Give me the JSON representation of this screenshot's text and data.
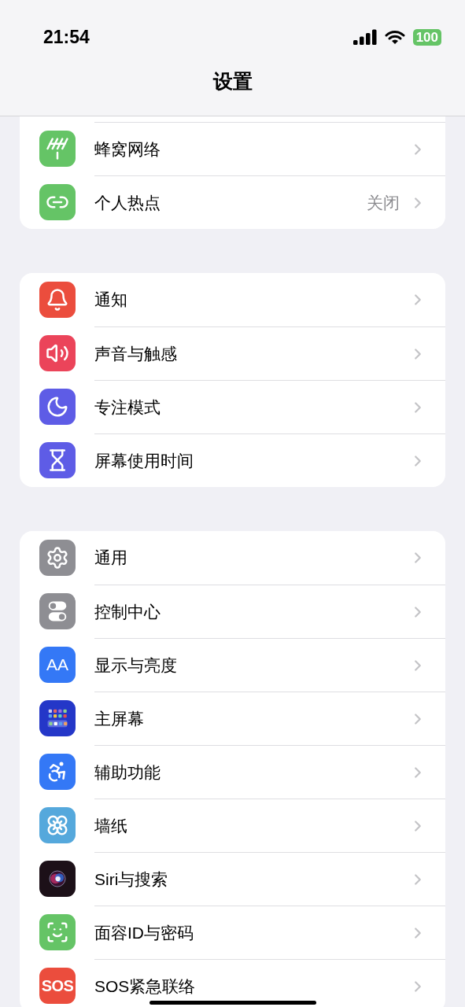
{
  "status_bar": {
    "time": "21:54",
    "battery": "100"
  },
  "title": "设置",
  "groups": [
    {
      "items": [
        {
          "label": "蜂窝网络"
        },
        {
          "label": "个人热点",
          "value": "关闭"
        }
      ]
    },
    {
      "items": [
        {
          "label": "通知"
        },
        {
          "label": "声音与触感"
        },
        {
          "label": "专注模式"
        },
        {
          "label": "屏幕使用时间"
        }
      ]
    },
    {
      "items": [
        {
          "label": "通用"
        },
        {
          "label": "控制中心"
        },
        {
          "label": "显示与亮度",
          "icon_text": "AA"
        },
        {
          "label": "主屏幕"
        },
        {
          "label": "辅助功能"
        },
        {
          "label": "墙纸"
        },
        {
          "label": "Siri与搜索"
        },
        {
          "label": "面容ID与密码"
        },
        {
          "label": "SOS紧急联络",
          "icon_text": "SOS"
        }
      ]
    }
  ]
}
